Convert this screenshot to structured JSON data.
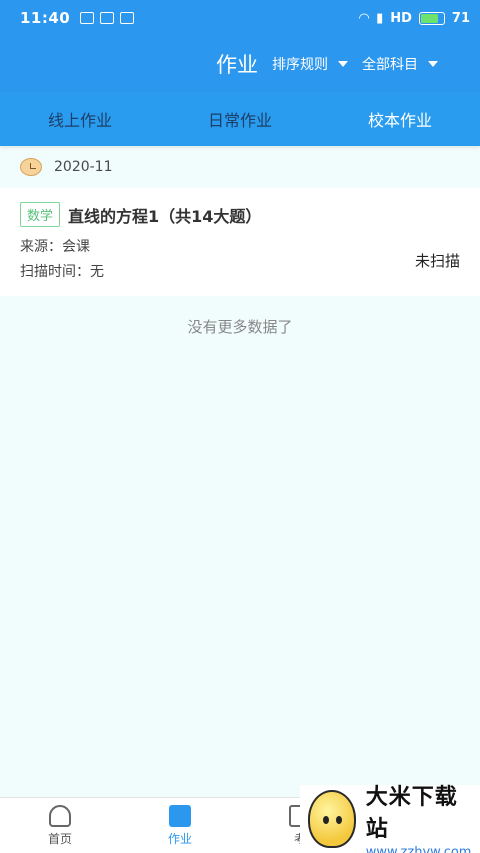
{
  "status_bar": {
    "time": "11:40",
    "network": "HD",
    "battery": "71"
  },
  "header": {
    "title": "作业",
    "sort_label": "排序规则",
    "subject_label": "全部科目"
  },
  "tabs": [
    {
      "label": "线上作业",
      "active": false
    },
    {
      "label": "日常作业",
      "active": false
    },
    {
      "label": "校本作业",
      "active": true
    }
  ],
  "month": "2020-11",
  "assignment": {
    "subject": "数学",
    "title": "直线的方程1（共14大题）",
    "source": "来源：会课",
    "scan_time": "扫描时间：无",
    "status": "未扫描"
  },
  "no_more": "没有更多数据了",
  "bottom_nav": [
    {
      "label": "首页",
      "icon": "home-icon"
    },
    {
      "label": "作业",
      "icon": "homework-icon",
      "active": true
    },
    {
      "label": "考",
      "icon": "exam-icon"
    }
  ],
  "watermark": {
    "title": "大米下载站",
    "url": "www.zzhyw.com"
  }
}
